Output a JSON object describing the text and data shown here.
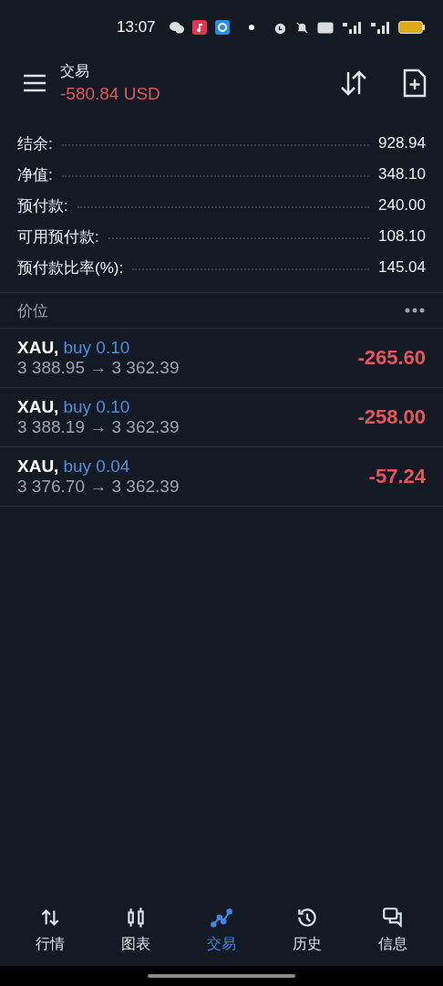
{
  "status_bar": {
    "time": "13:07"
  },
  "header": {
    "title": "交易",
    "balance": "-580.84 USD"
  },
  "account": [
    {
      "label": "结余:",
      "value": "928.94"
    },
    {
      "label": "净值:",
      "value": "348.10"
    },
    {
      "label": "预付款:",
      "value": "240.00"
    },
    {
      "label": "可用预付款:",
      "value": "108.10"
    },
    {
      "label": "预付款比率(%):",
      "value": "145.04"
    }
  ],
  "section": {
    "title": "价位"
  },
  "positions": [
    {
      "symbol": "XAU,",
      "side": "buy 0.10",
      "prices": "3 388.95 → 3 362.39",
      "profit": "-265.60"
    },
    {
      "symbol": "XAU,",
      "side": "buy 0.10",
      "prices": "3 388.19 → 3 362.39",
      "profit": "-258.00"
    },
    {
      "symbol": "XAU,",
      "side": "buy 0.04",
      "prices": "3 376.70 → 3 362.39",
      "profit": "-57.24"
    }
  ],
  "nav": [
    {
      "kind": "quotes",
      "label": "行情",
      "selected": false
    },
    {
      "kind": "chart",
      "label": "图表",
      "selected": false
    },
    {
      "kind": "trade",
      "label": "交易",
      "selected": true
    },
    {
      "kind": "history",
      "label": "历史",
      "selected": false
    },
    {
      "kind": "messages",
      "label": "信息",
      "selected": false
    }
  ]
}
